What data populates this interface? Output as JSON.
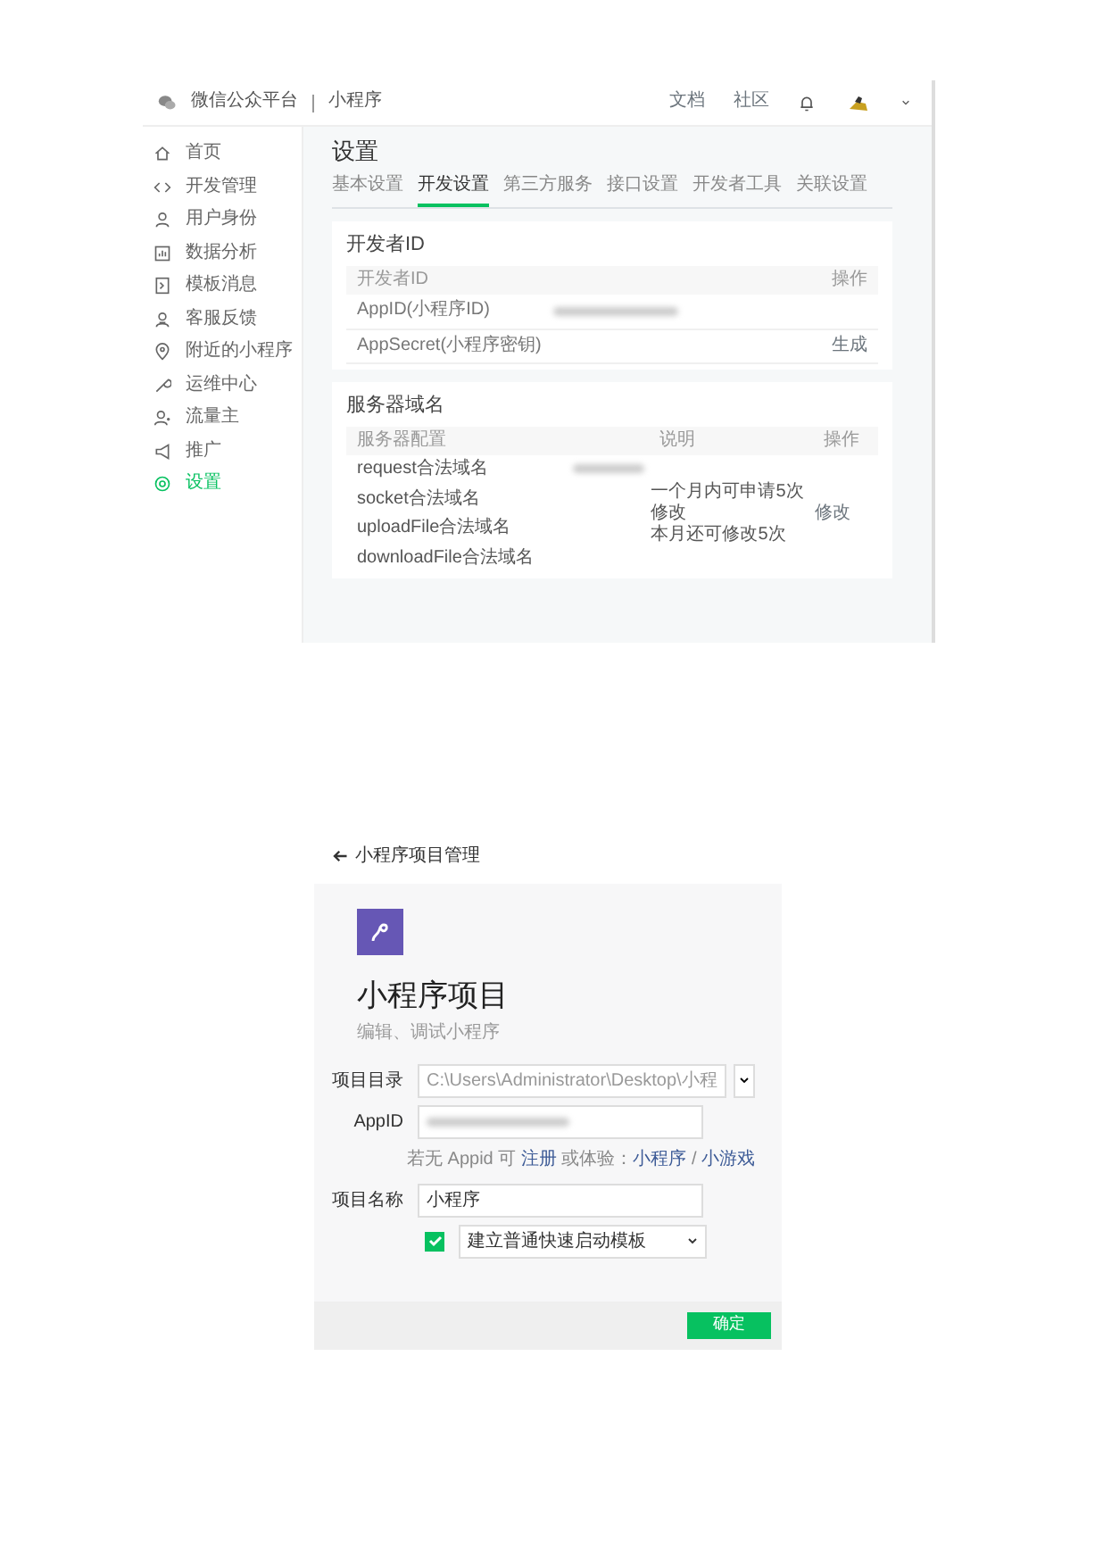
{
  "admin": {
    "brand": "微信公众平台",
    "product": "小程序",
    "header_links": [
      "文档",
      "社区"
    ],
    "sidebar": [
      {
        "label": "首页",
        "selected": false
      },
      {
        "label": "开发管理",
        "selected": false
      },
      {
        "label": "用户身份",
        "selected": false
      },
      {
        "label": "数据分析",
        "selected": false
      },
      {
        "label": "模板消息",
        "selected": false
      },
      {
        "label": "客服反馈",
        "selected": false
      },
      {
        "label": "附近的小程序",
        "selected": false
      },
      {
        "label": "运维中心",
        "selected": false
      },
      {
        "label": "流量主",
        "selected": false
      },
      {
        "label": "推广",
        "selected": false
      },
      {
        "label": "设置",
        "selected": true
      }
    ],
    "page_title": "设置",
    "tabs": [
      {
        "label": "基本设置",
        "selected": false
      },
      {
        "label": "开发设置",
        "selected": true
      },
      {
        "label": "第三方服务",
        "selected": false
      },
      {
        "label": "接口设置",
        "selected": false
      },
      {
        "label": "开发者工具",
        "selected": false
      },
      {
        "label": "关联设置",
        "selected": false
      }
    ],
    "developer_id": {
      "title": "开发者ID",
      "columns": [
        "开发者ID",
        "操作"
      ],
      "rows": [
        {
          "label": "AppID(小程序ID)",
          "masked": true
        },
        {
          "label": "AppSecret(小程序密钥)",
          "masked": false,
          "action": "生成"
        }
      ]
    },
    "server_domain": {
      "title": "服务器域名",
      "columns": [
        "服务器配置",
        "说明",
        "操作"
      ],
      "rows": [
        {
          "label": "request合法域名",
          "masked": true
        },
        {
          "label": "socket合法域名",
          "masked": false
        },
        {
          "label": "uploadFile合法域名",
          "masked": false
        },
        {
          "label": "downloadFile合法域名",
          "masked": false
        }
      ],
      "note_lines": [
        "一个月内可申请5次修改",
        "本月还可修改5次"
      ],
      "action": "修改"
    }
  },
  "project": {
    "back_link": "小程序项目管理",
    "title": "小程序项目",
    "subtitle": "编辑、调试小程序",
    "fields": [
      {
        "kind": "path",
        "label": "项目目录",
        "value": "C:\\Users\\Administrator\\Desktop\\小程"
      },
      {
        "kind": "masked",
        "label": "AppID"
      },
      {
        "kind": "text",
        "label": "项目名称",
        "value": "小程序"
      }
    ],
    "hint": [
      {
        "text": "若无 Appid 可 ",
        "link": false
      },
      {
        "text": "注册",
        "link": true
      },
      {
        "text": " 或体验：",
        "link": false
      },
      {
        "text": "小程序",
        "link": true
      },
      {
        "text": " / ",
        "link": false
      },
      {
        "text": "小游戏",
        "link": true
      }
    ],
    "template": {
      "checked": true,
      "value": "建立普通快速启动模板"
    },
    "confirm": "确定"
  }
}
